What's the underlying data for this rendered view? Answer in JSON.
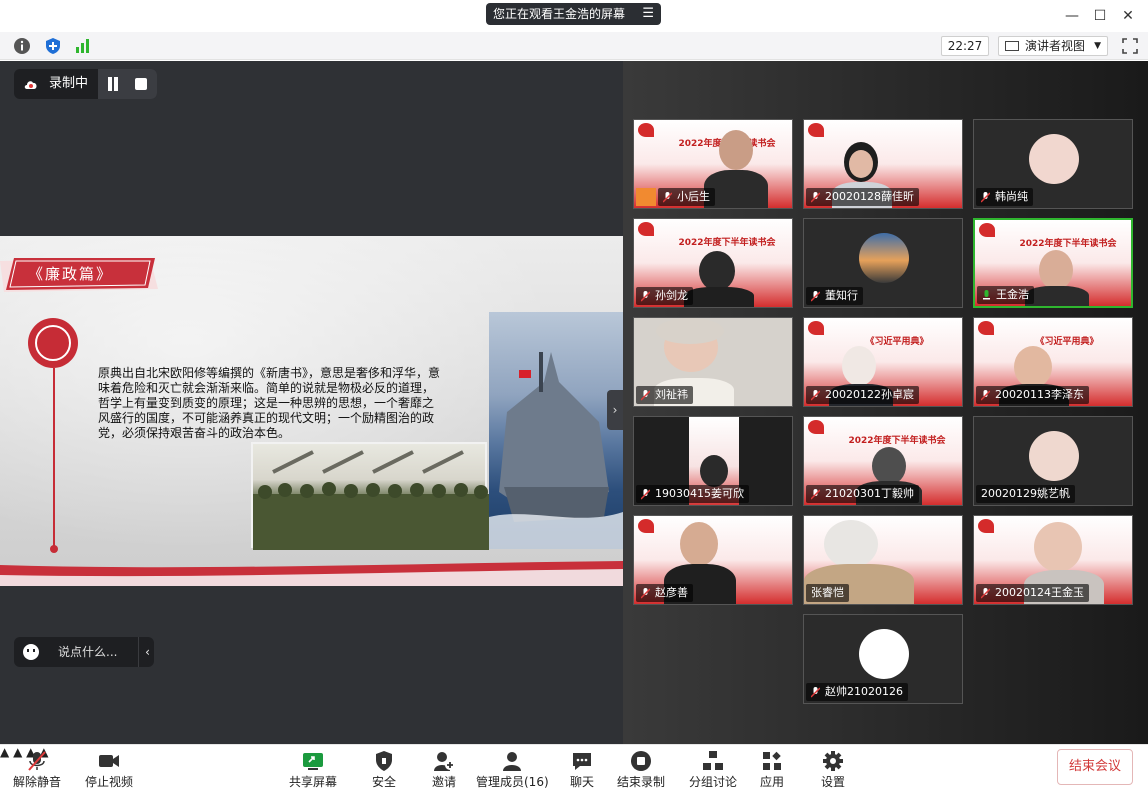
{
  "window": {
    "share_banner": "您正在观看王金浩的屏幕",
    "share_banner_menu_icon": "menu-lines-icon"
  },
  "toolbar": {
    "clock": "22:27",
    "view_select": "演讲者视图"
  },
  "recording": {
    "label": "录制中"
  },
  "slide": {
    "title": "《廉政篇》",
    "body": "原典出自北宋欧阳修等编撰的《新唐书》，意思是奢侈和浮华，意味着危险和灭亡就会渐渐来临。简单的说就是物极必反的道理，哲学上有量变到质变的原理；这是一种思辨的思想，一个奢靡之风盛行的国度，不可能涵养真正的现代文明；一个励精图治的政党，必须保持艰苦奋斗的政治本色。"
  },
  "chat": {
    "placeholder": "说点什么..."
  },
  "participants": [
    {
      "name": "小后生"
    },
    {
      "name": "20020128薛佳昕"
    },
    {
      "name": "韩尚纯"
    },
    {
      "name": "孙剑龙"
    },
    {
      "name": "董知行"
    },
    {
      "name": "王金浩"
    },
    {
      "name": "刘祉祎"
    },
    {
      "name": "20020122孙卓宸"
    },
    {
      "name": "20020113李泽东"
    },
    {
      "name": "19030415姜可欣"
    },
    {
      "name": "21020301丁毅帅"
    },
    {
      "name": "20020129姚艺帆"
    },
    {
      "name": "赵彦善"
    },
    {
      "name": "张睿恺"
    },
    {
      "name": "20020124王金玉"
    },
    {
      "name": "赵帅21020126"
    }
  ],
  "tile_banner": {
    "line1": "2022年度下半年读书会",
    "line2": "《习近平用典》"
  },
  "bottom_bar": {
    "mute": "解除静音",
    "video": "停止视频",
    "share": "共享屏幕",
    "security": "安全",
    "invite": "邀请",
    "participants": "管理成员(16)",
    "chat": "聊天",
    "end_recording": "结束录制",
    "breakout": "分组讨论",
    "apps": "应用",
    "settings": "设置",
    "end_meeting": "结束会议"
  },
  "colors": {
    "accent_red": "#c62c36",
    "active_speaker": "#2fb62f",
    "dark_stage": "#2f3135"
  }
}
